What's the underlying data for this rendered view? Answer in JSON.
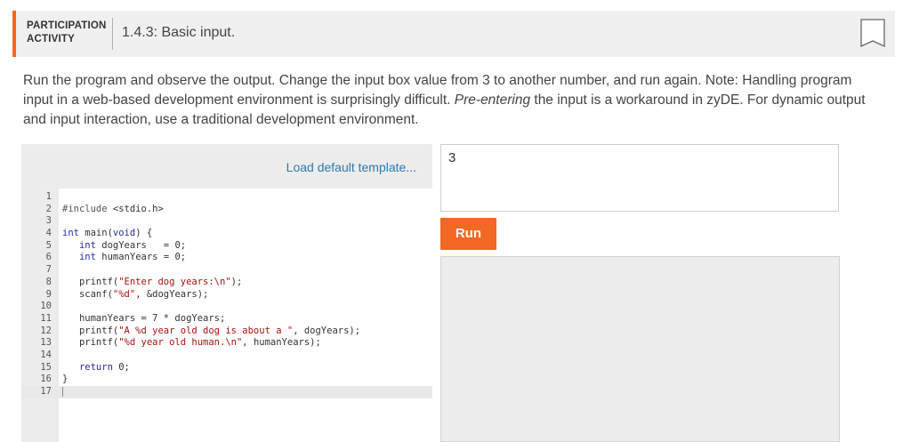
{
  "activity": {
    "label_line1": "PARTICIPATION",
    "label_line2": "ACTIVITY",
    "title": "1.4.3: Basic input.",
    "accent_color": "#f26722",
    "bookmark_icon": "bookmark-icon"
  },
  "instructions": {
    "part1": "Run the program and observe the output. Change the input box value from 3 to another number, and run again. Note: Handling program input in a web-based development environment is surprisingly difficult. ",
    "emphasis": "Pre-entering",
    "part2": " the input is a workaround in zyDE. For dynamic output and input interaction, use a traditional development environment."
  },
  "editor": {
    "load_template_label": "Load default template...",
    "lines": [
      "",
      "#include <stdio.h>",
      "",
      "int main(void) {",
      "   int dogYears   = 0;",
      "   int humanYears = 0;",
      "",
      "   printf(\"Enter dog years:\\n\");",
      "   scanf(\"%d\", &dogYears);",
      "",
      "   humanYears = 7 * dogYears;",
      "   printf(\"A %d year old dog is about a \", dogYears);",
      "   printf(\"%d year old human.\\n\", humanYears);",
      "",
      "   return 0;",
      "}",
      ""
    ],
    "active_line": 17
  },
  "input": {
    "value": "3"
  },
  "run": {
    "label": "Run"
  }
}
